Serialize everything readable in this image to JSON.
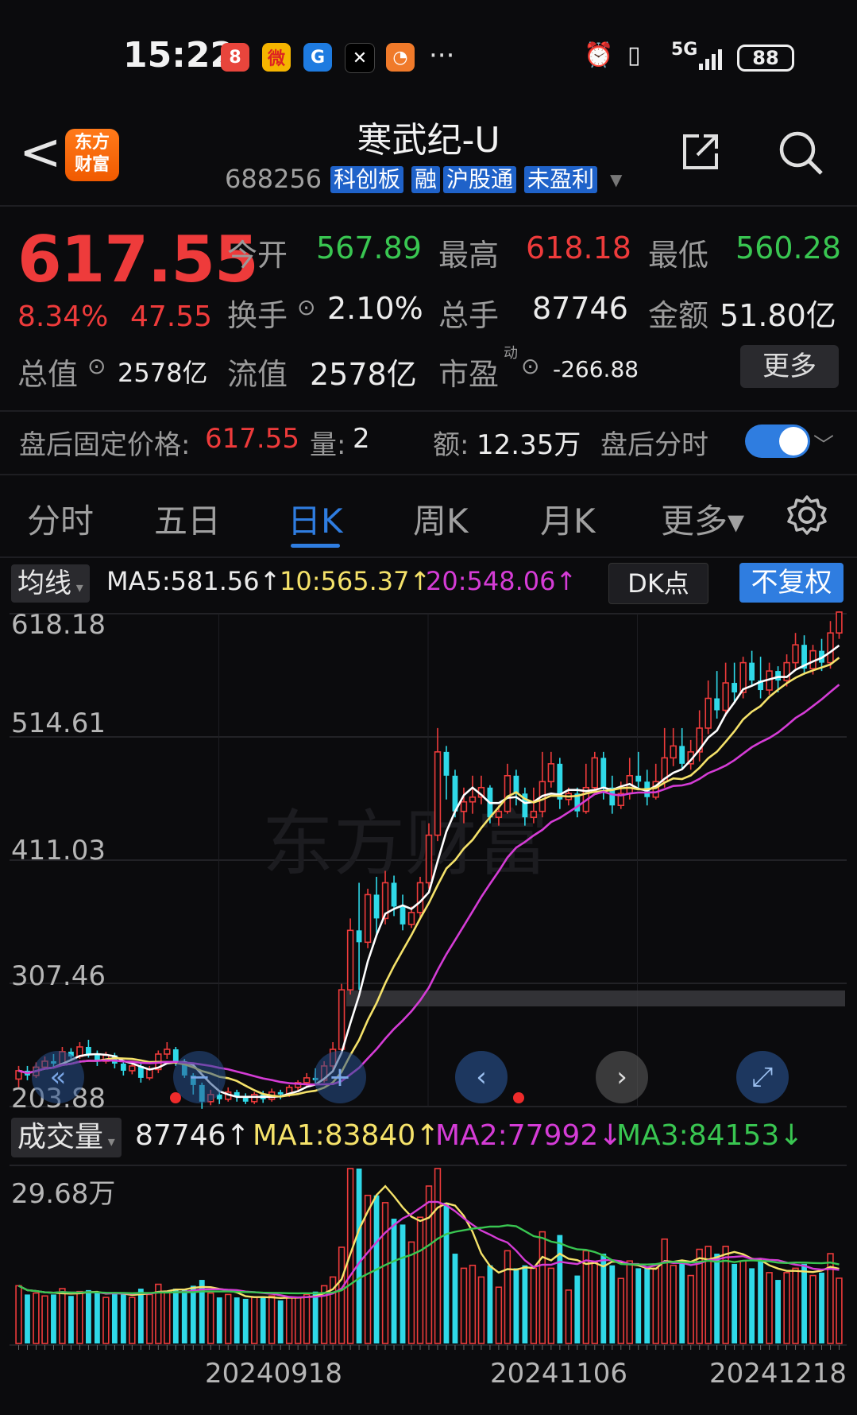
{
  "status_bar": {
    "time": "15:22",
    "apps": [
      {
        "name": "app-red-icon",
        "glyph": "8",
        "color": "#e8453c"
      },
      {
        "name": "weibo-icon",
        "glyph": "微",
        "color": "#f5b400"
      },
      {
        "name": "blue-app-icon",
        "glyph": "G",
        "color": "#1e7be0"
      },
      {
        "name": "black-app-icon",
        "glyph": "✕",
        "color": "#000000"
      },
      {
        "name": "orange-app-icon",
        "glyph": "◔",
        "color": "#f07a2a"
      }
    ],
    "more": "···",
    "network": "5G",
    "battery": "88"
  },
  "header": {
    "back": "<",
    "logo_line1": "东方",
    "logo_line2": "财富",
    "title": "寒武纪-U",
    "code": "688256",
    "tags": [
      "科创板",
      "融",
      "沪股通",
      "未盈利"
    ]
  },
  "quote": {
    "price": "617.55",
    "pct": "8.34%",
    "change": "47.55",
    "open_label": "今开",
    "open": "567.89",
    "high_label": "最高",
    "high": "618.18",
    "low_label": "最低",
    "low": "560.28",
    "turnover_label": "换手",
    "turnover": "2.10%",
    "volume_label": "总手",
    "volume": "87746",
    "amount_label": "金额",
    "amount": "51.80亿",
    "total_cap_label": "总值",
    "total_cap": "2578亿",
    "float_cap_label": "流值",
    "float_cap": "2578亿",
    "pe_label": "市盈",
    "pe_sup": "动",
    "pe": "-266.88",
    "more_button": "更多"
  },
  "after_hours": {
    "price_label": "盘后固定价格:",
    "price": "617.55",
    "vol_label": "量:",
    "vol": "2",
    "amt_label": "额:",
    "amt": "12.35万",
    "toggle_label": "盘后分时",
    "toggle_on": true
  },
  "tabs": [
    {
      "label": "分时",
      "active": false
    },
    {
      "label": "五日",
      "active": false
    },
    {
      "label": "日K",
      "active": true
    },
    {
      "label": "周K",
      "active": false
    },
    {
      "label": "月K",
      "active": false
    },
    {
      "label": "更多▾",
      "active": false
    }
  ],
  "ma_bar": {
    "selector": "均线",
    "ma5": "MA5:581.56↑",
    "ma10": "10:565.37↑",
    "ma20": "20:548.06↑",
    "dk": "DK点",
    "adjust": "不复权"
  },
  "kline_axis": [
    "618.18",
    "514.61",
    "411.03",
    "307.46",
    "203.88"
  ],
  "volume_bar": {
    "selector": "成交量",
    "vol": "87746↑",
    "ma1": "MA1:83840↑",
    "ma2": "MA2:77992↓",
    "ma3": "MA3:84153↓",
    "axis_top": "29.68万"
  },
  "dates": [
    "20240918",
    "20241106",
    "20241218"
  ],
  "colors": {
    "up": "#ee3b3b",
    "down": "#2fd9e8",
    "ma5": "#ffffff",
    "ma10": "#f5e26a",
    "ma20": "#d53cd6",
    "ma3": "#39c651",
    "accent": "#2f7de0"
  },
  "chart_data": {
    "type": "candlestick",
    "y_range": [
      203.88,
      618.18
    ],
    "candles": [
      [
        225,
        232,
        218,
        236
      ],
      [
        232,
        228,
        224,
        236
      ],
      [
        228,
        235,
        226,
        239
      ],
      [
        235,
        240,
        233,
        244
      ],
      [
        240,
        238,
        234,
        246
      ],
      [
        238,
        248,
        236,
        252
      ],
      [
        248,
        244,
        240,
        251
      ],
      [
        244,
        252,
        242,
        256
      ],
      [
        252,
        246,
        243,
        258
      ],
      [
        246,
        240,
        236,
        249
      ],
      [
        240,
        245,
        238,
        248
      ],
      [
        245,
        238,
        234,
        247
      ],
      [
        238,
        232,
        228,
        240
      ],
      [
        232,
        236,
        229,
        239
      ],
      [
        236,
        226,
        222,
        238
      ],
      [
        226,
        233,
        224,
        236
      ],
      [
        233,
        246,
        230,
        249
      ],
      [
        246,
        250,
        242,
        256
      ],
      [
        250,
        240,
        236,
        252
      ],
      [
        240,
        228,
        226,
        242
      ],
      [
        228,
        220,
        212,
        230
      ],
      [
        220,
        206,
        200,
        222
      ],
      [
        206,
        212,
        203,
        216
      ],
      [
        212,
        208,
        204,
        214
      ],
      [
        208,
        214,
        206,
        218
      ],
      [
        214,
        210,
        206,
        216
      ],
      [
        210,
        206,
        204,
        213
      ],
      [
        206,
        212,
        204,
        214
      ],
      [
        212,
        208,
        205,
        215
      ],
      [
        208,
        214,
        206,
        217
      ],
      [
        214,
        212,
        208,
        216
      ],
      [
        212,
        218,
        210,
        220
      ],
      [
        218,
        222,
        214,
        224
      ],
      [
        222,
        226,
        218,
        230
      ],
      [
        226,
        224,
        220,
        234
      ],
      [
        224,
        236,
        222,
        240
      ],
      [
        236,
        250,
        232,
        256
      ],
      [
        250,
        300,
        248,
        305
      ],
      [
        300,
        350,
        296,
        360
      ],
      [
        350,
        340,
        300,
        390
      ],
      [
        340,
        380,
        335,
        385
      ],
      [
        380,
        360,
        345,
        395
      ],
      [
        360,
        390,
        355,
        400
      ],
      [
        390,
        370,
        362,
        396
      ],
      [
        370,
        355,
        350,
        380
      ],
      [
        355,
        365,
        352,
        370
      ],
      [
        365,
        390,
        360,
        395
      ],
      [
        390,
        430,
        385,
        440
      ],
      [
        430,
        500,
        425,
        520
      ],
      [
        500,
        480,
        460,
        505
      ],
      [
        480,
        450,
        445,
        485
      ],
      [
        450,
        458,
        440,
        470
      ],
      [
        458,
        462,
        448,
        480
      ],
      [
        462,
        470,
        456,
        480
      ],
      [
        470,
        445,
        440,
        472
      ],
      [
        445,
        450,
        438,
        455
      ],
      [
        450,
        480,
        448,
        490
      ],
      [
        480,
        465,
        455,
        485
      ],
      [
        465,
        445,
        438,
        470
      ],
      [
        445,
        450,
        440,
        470
      ],
      [
        450,
        475,
        445,
        500
      ],
      [
        475,
        490,
        470,
        500
      ],
      [
        490,
        460,
        452,
        495
      ],
      [
        460,
        465,
        455,
        470
      ],
      [
        465,
        450,
        445,
        470
      ],
      [
        450,
        470,
        448,
        490
      ],
      [
        470,
        495,
        466,
        500
      ],
      [
        495,
        470,
        460,
        500
      ],
      [
        470,
        455,
        448,
        480
      ],
      [
        455,
        465,
        452,
        475
      ],
      [
        465,
        480,
        460,
        495
      ],
      [
        480,
        475,
        470,
        500
      ],
      [
        475,
        462,
        455,
        485
      ],
      [
        462,
        475,
        460,
        490
      ],
      [
        475,
        495,
        470,
        520
      ],
      [
        495,
        505,
        488,
        520
      ],
      [
        505,
        490,
        485,
        520
      ],
      [
        490,
        500,
        485,
        510
      ],
      [
        500,
        520,
        492,
        535
      ],
      [
        520,
        545,
        515,
        560
      ],
      [
        545,
        535,
        528,
        568
      ],
      [
        535,
        558,
        530,
        575
      ],
      [
        558,
        550,
        542,
        575
      ],
      [
        550,
        575,
        545,
        580
      ],
      [
        575,
        560,
        555,
        585
      ],
      [
        560,
        552,
        545,
        580
      ],
      [
        552,
        568,
        548,
        575
      ],
      [
        568,
        560,
        550,
        572
      ],
      [
        560,
        575,
        555,
        582
      ],
      [
        575,
        590,
        570,
        600
      ],
      [
        590,
        570,
        565,
        598
      ],
      [
        570,
        585,
        565,
        590
      ],
      [
        585,
        575,
        568,
        595
      ],
      [
        575,
        600,
        570,
        610
      ],
      [
        600,
        617.55,
        595,
        618.18
      ]
    ],
    "ma5_label": "MA5:581.56",
    "ma10_label": "10:565.37",
    "ma20_label": "20:548.06"
  }
}
